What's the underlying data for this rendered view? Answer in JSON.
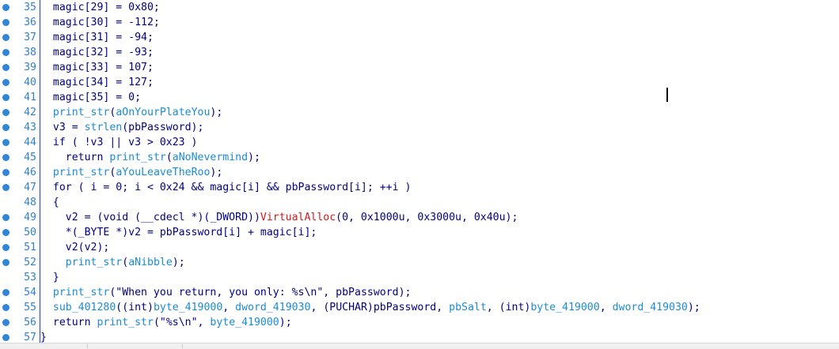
{
  "gutter": {
    "line_numbers": [
      "35",
      "36",
      "37",
      "38",
      "39",
      "40",
      "41",
      "42",
      "43",
      "44",
      "45",
      "46",
      "47",
      "48",
      "49",
      "50",
      "51",
      "52",
      "53",
      "54",
      "55",
      "56",
      "57"
    ],
    "has_dot": [
      true,
      true,
      true,
      true,
      true,
      true,
      true,
      true,
      true,
      true,
      true,
      true,
      true,
      false,
      true,
      true,
      true,
      true,
      false,
      true,
      true,
      true,
      true
    ]
  },
  "colors": {
    "code": "#000080",
    "function_name": "#1a8cd4",
    "api_call": "#d81818",
    "line_number": "#2f7fd0",
    "breakpoint_dot": "#2f86d6",
    "gutter_border": "#1e4e9a"
  },
  "code_lines": [
    [
      {
        "t": "  magic[29] = 0x80;",
        "c": "code-text"
      }
    ],
    [
      {
        "t": "  magic[30] = -112;",
        "c": "code-text"
      }
    ],
    [
      {
        "t": "  magic[31] = -94;",
        "c": "code-text"
      }
    ],
    [
      {
        "t": "  magic[32] = -93;",
        "c": "code-text"
      }
    ],
    [
      {
        "t": "  magic[33] = 107;",
        "c": "code-text"
      }
    ],
    [
      {
        "t": "  magic[34] = 127;",
        "c": "code-text"
      }
    ],
    [
      {
        "t": "  magic[35] = 0;",
        "c": "code-text"
      }
    ],
    [
      {
        "t": "  ",
        "c": "code-text"
      },
      {
        "t": "print_str",
        "c": "fn"
      },
      {
        "t": "(",
        "c": "code-text"
      },
      {
        "t": "aOnYourPlateYou",
        "c": "fn"
      },
      {
        "t": ");",
        "c": "code-text"
      }
    ],
    [
      {
        "t": "  v3 = ",
        "c": "code-text"
      },
      {
        "t": "strlen",
        "c": "fn"
      },
      {
        "t": "(pbPassword);",
        "c": "code-text"
      }
    ],
    [
      {
        "t": "  if ( !v3 || v3 > 0x23 )",
        "c": "code-text"
      }
    ],
    [
      {
        "t": "    return ",
        "c": "code-text"
      },
      {
        "t": "print_str",
        "c": "fn"
      },
      {
        "t": "(",
        "c": "code-text"
      },
      {
        "t": "aNoNevermind",
        "c": "fn"
      },
      {
        "t": ");",
        "c": "code-text"
      }
    ],
    [
      {
        "t": "  ",
        "c": "code-text"
      },
      {
        "t": "print_str",
        "c": "fn"
      },
      {
        "t": "(",
        "c": "code-text"
      },
      {
        "t": "aYouLeaveTheRoo",
        "c": "fn"
      },
      {
        "t": ");",
        "c": "code-text"
      }
    ],
    [
      {
        "t": "  for ( i = 0; i < 0x24 && magic[i] && pbPassword[i]; ++i )",
        "c": "code-text"
      }
    ],
    [
      {
        "t": "  {",
        "c": "code-text"
      }
    ],
    [
      {
        "t": "    v2 = (void (__cdecl *)(_DWORD))",
        "c": "code-text"
      },
      {
        "t": "VirtualAlloc",
        "c": "red"
      },
      {
        "t": "(0, 0x1000u, 0x3000u, 0x40u);",
        "c": "code-text"
      }
    ],
    [
      {
        "t": "    *(_BYTE *)v2 = pbPassword[i] + magic[i];",
        "c": "code-text"
      }
    ],
    [
      {
        "t": "    v2(v2);",
        "c": "code-text"
      }
    ],
    [
      {
        "t": "    ",
        "c": "code-text"
      },
      {
        "t": "print_str",
        "c": "fn"
      },
      {
        "t": "(",
        "c": "code-text"
      },
      {
        "t": "aNibble",
        "c": "fn"
      },
      {
        "t": ");",
        "c": "code-text"
      }
    ],
    [
      {
        "t": "  }",
        "c": "code-text"
      }
    ],
    [
      {
        "t": "  ",
        "c": "code-text"
      },
      {
        "t": "print_str",
        "c": "fn"
      },
      {
        "t": "(\"When you return, you only: %s\\n\", pbPassword);",
        "c": "code-text"
      }
    ],
    [
      {
        "t": "  ",
        "c": "code-text"
      },
      {
        "t": "sub_401280",
        "c": "fn"
      },
      {
        "t": "((int)",
        "c": "code-text"
      },
      {
        "t": "byte_419000",
        "c": "fn"
      },
      {
        "t": ", ",
        "c": "code-text"
      },
      {
        "t": "dword_419030",
        "c": "fn"
      },
      {
        "t": ", (PUCHAR)pbPassword, ",
        "c": "code-text"
      },
      {
        "t": "pbSalt",
        "c": "fn"
      },
      {
        "t": ", (int)",
        "c": "code-text"
      },
      {
        "t": "byte_419000",
        "c": "fn"
      },
      {
        "t": ", ",
        "c": "code-text"
      },
      {
        "t": "dword_419030",
        "c": "fn"
      },
      {
        "t": ");",
        "c": "code-text"
      }
    ],
    [
      {
        "t": "  return ",
        "c": "code-text"
      },
      {
        "t": "print_str",
        "c": "fn"
      },
      {
        "t": "(\"%s\\n\", ",
        "c": "code-text"
      },
      {
        "t": "byte_419000",
        "c": "fn"
      },
      {
        "t": ");",
        "c": "code-text"
      }
    ],
    [
      {
        "t": "}",
        "c": "code-text"
      }
    ]
  ]
}
